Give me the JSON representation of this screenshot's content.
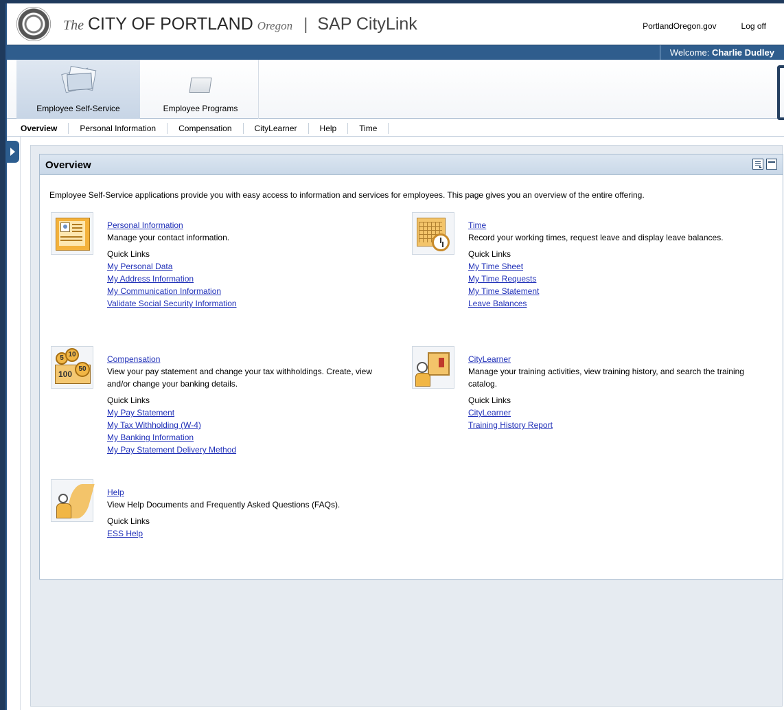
{
  "header": {
    "brand_the": "The",
    "brand_city": "CITY OF PORTLAND",
    "brand_oregon": "Oregon",
    "brand_separator": "|",
    "brand_app": "SAP CityLink",
    "link_portal": "PortlandOregon.gov",
    "link_logoff": "Log off"
  },
  "welcome": {
    "prefix": "Welcome:",
    "user": "Charlie Dudley"
  },
  "nav1": {
    "tabs": [
      {
        "label": "Employee Self-Service",
        "icon": "documents-icon",
        "active": true
      },
      {
        "label": "Employee Programs",
        "icon": "folder-icon",
        "active": false
      }
    ]
  },
  "nav2": {
    "tabs": [
      {
        "label": "Overview",
        "active": true
      },
      {
        "label": "Personal Information"
      },
      {
        "label": "Compensation"
      },
      {
        "label": "CityLearner"
      },
      {
        "label": "Help"
      },
      {
        "label": "Time"
      }
    ]
  },
  "panel": {
    "title": "Overview",
    "intro": "Employee Self-Service applications provide you with easy access to information and services for employees.  This page gives you an overview of the entire offering."
  },
  "services": {
    "personal": {
      "title": "Personal Information",
      "desc": "Manage your contact information.",
      "quick": "Quick Links",
      "links": [
        "My Personal Data",
        "My Address Information",
        "My Communication Information",
        "Validate Social Security Information"
      ]
    },
    "time": {
      "title": "Time",
      "desc": "Record your working times, request leave and display leave balances.",
      "quick": "Quick Links",
      "links": [
        "My Time Sheet",
        "My Time Requests",
        "My Time Statement",
        "Leave Balances"
      ]
    },
    "compensation": {
      "title": "Compensation",
      "desc": "View your pay statement and change your tax withholdings.  Create, view and/or change your banking details.",
      "quick": "Quick Links",
      "links": [
        "My Pay Statement",
        "My Tax Withholding (W-4)",
        "My Banking Information",
        "My Pay Statement Delivery Method"
      ],
      "icon_values": [
        "5",
        "10",
        "100",
        "50"
      ]
    },
    "citylearner": {
      "title": "CityLearner",
      "desc": "Manage your training activities, view training history, and search the training catalog.",
      "quick": "Quick Links",
      "links": [
        "CityLearner",
        "Training History Report"
      ]
    },
    "help": {
      "title": "Help",
      "desc": "View Help Documents and Frequently Asked Questions (FAQs).",
      "quick": "Quick Links",
      "links": [
        "ESS Help"
      ]
    }
  },
  "colors": {
    "welcome_bar": "#2f5d8d",
    "link": "#1f2fb8",
    "panel_header": "#c9d8e8",
    "icon_gold": "#f1b645"
  }
}
